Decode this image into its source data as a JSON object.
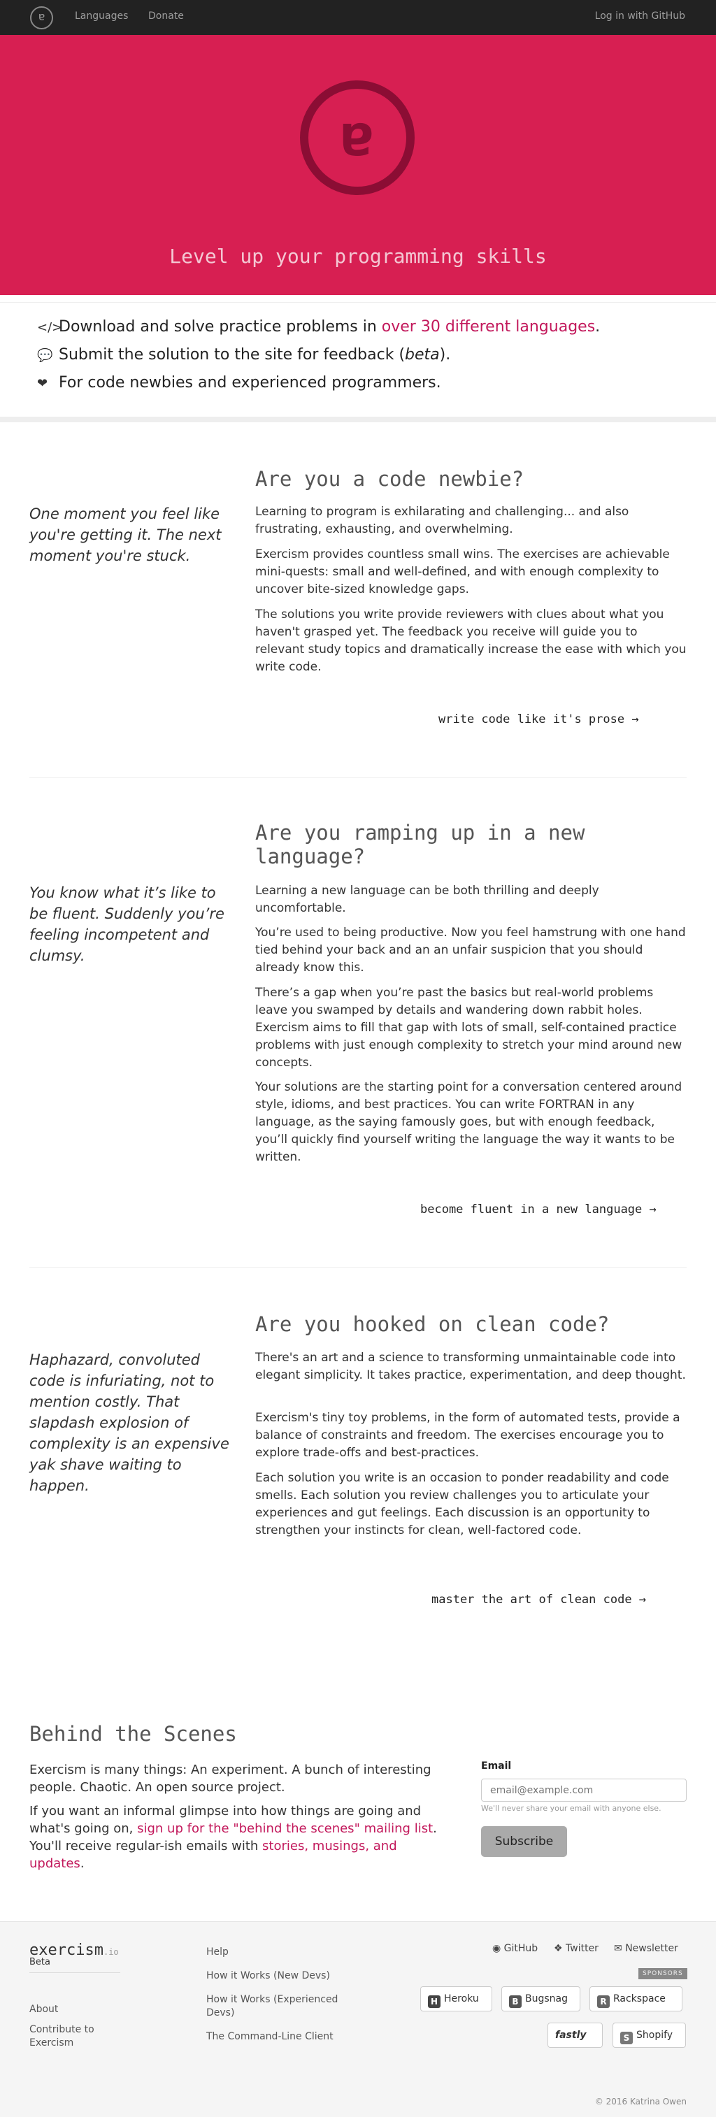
{
  "nav": {
    "logo_glyph": "ɐ",
    "languages": "Languages",
    "donate": "Donate",
    "login": "Log in with GitHub"
  },
  "hero": {
    "logo_glyph": "ɐ",
    "tagline": "Level up your programming skills"
  },
  "features": [
    {
      "icon": "code-icon",
      "text_before": "Download and solve practice problems in ",
      "link": "over 30 different languages",
      "text_after": "."
    },
    {
      "icon": "comment-icon",
      "text_before": "Submit the solution to the site for feedback (",
      "italic": "beta",
      "text_after": ")."
    },
    {
      "icon": "heart-icon",
      "text": "For code newbies and experienced programmers."
    }
  ],
  "sections": [
    {
      "quote": "One moment you feel like you're getting it. The next moment you're stuck.",
      "title": "Are you a code newbie?",
      "paragraphs": [
        "Learning to program is exhilarating and challenging... and also frustrating, exhausting, and overwhelming.",
        "Exercism provides countless small wins. The exercises are achievable mini-quests: small and well-defined, and with enough complexity to uncover bite-sized knowledge gaps.",
        "The solutions you write provide reviewers with clues about what you haven't grasped yet. The feedback you receive will guide you to relevant study topics and dramatically increase the ease with which you write code."
      ],
      "cta": "write code like it's prose →"
    },
    {
      "quote": "You know what it’s like to be fluent. Suddenly you’re feeling incompetent and clumsy.",
      "title": "Are you ramping up in a new language?",
      "paragraphs": [
        "Learning a new language can be both thrilling and deeply uncomfortable.",
        "You’re used to being productive. Now you feel hamstrung with one hand tied behind your back and an an unfair suspicion that you should already know this.",
        "There’s a gap when you’re past the basics but real-world problems leave you swamped by details and wandering down rabbit holes. Exercism aims to fill that gap with lots of small, self-contained practice problems with just enough complexity to stretch your mind around new concepts.",
        "Your solutions are the starting point for a conversation centered around style, idioms, and best practices. You can write FORTRAN in any language, as the saying famously goes, but with enough feedback, you’ll quickly find yourself writing the language the way it wants to be written."
      ],
      "cta": "become fluent in a new language →"
    },
    {
      "quote": "Haphazard, convoluted code is infuriating, not to mention costly. That slapdash explosion of complexity is an expensive yak shave waiting to happen.",
      "title": "Are you hooked on clean code?",
      "paragraphs": [
        "There's an art and a science to transforming unmaintainable code into elegant simplicity. It takes practice, experimentation, and deep thought.",
        "Exercism's tiny toy problems, in the form of automated tests, provide a balance of constraints and freedom. The exercises encourage you to explore trade-offs and best-practices.",
        "Each solution you write is an occasion to ponder readability and code smells. Each solution you review challenges you to articulate your experiences and gut feelings. Each discussion is an opportunity to strengthen your instincts for clean, well-factored code."
      ],
      "cta": "master the art of clean code →"
    }
  ],
  "behind": {
    "title": "Behind the Scenes",
    "p1": "Exercism is many things: An experiment. A bunch of interesting people. Chaotic. An open source project.",
    "p2_before": "If you want an informal glimpse into how things are going and what's going on, ",
    "p2_link1": "sign up for the \"behind the scenes\" mailing list",
    "p2_mid": ". You'll receive regular-ish emails with ",
    "p2_link2": "stories, musings, and updates",
    "p2_after": ".",
    "email_label": "Email",
    "email_placeholder": "email@example.com",
    "email_help": "We'll never share your email with anyone else.",
    "subscribe": "Subscribe"
  },
  "footer": {
    "logo": "exercism",
    "logo_suffix": ".io",
    "beta": "Beta",
    "about": "About",
    "contribute": "Contribute to Exercism",
    "help": "Help",
    "how_new": "How it Works (New Devs)",
    "how_exp": "How it Works (Experienced Devs)",
    "cli": "The Command-Line Client",
    "github": "GitHub",
    "twitter": "Twitter",
    "newsletter": "Newsletter",
    "sponsors_tag": "SPONSORS",
    "sponsors": [
      "Heroku",
      "Bugsnag",
      "Rackspace",
      "fastly",
      "Shopify"
    ],
    "copyright": "© 2016 Katrina Owen"
  },
  "colors": {
    "brand": "#d71f52",
    "brand_dark": "#8b0d34",
    "link": "#c2185b"
  }
}
